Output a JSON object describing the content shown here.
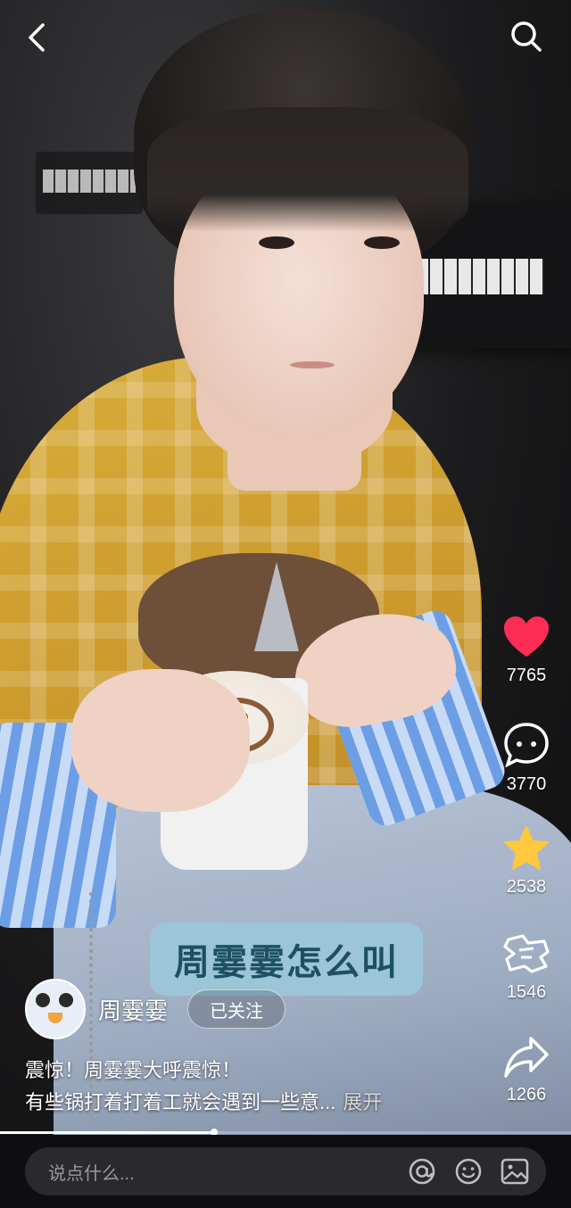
{
  "topbar": {
    "back_icon": "chevron-left-icon",
    "search_icon": "search-icon"
  },
  "actions": [
    {
      "icon": "heart-icon",
      "label": "7765",
      "color": "#ff2d55"
    },
    {
      "icon": "comment-icon",
      "label": "3770",
      "color": "#ffffff"
    },
    {
      "icon": "star-icon",
      "label": "2538",
      "color": "#ffc83d"
    },
    {
      "icon": "share-hand-icon",
      "label": "1546",
      "color": "#ffffff"
    },
    {
      "icon": "forward-icon",
      "label": "1266",
      "color": "#ffffff"
    }
  ],
  "caption_badge": "周霎霎怎么叫",
  "author": {
    "name": "周霎霎",
    "follow_label": "已关注"
  },
  "description": {
    "line1": "震惊！周霎霎大呼震惊！",
    "line2": "有些锅打着打着工就会遇到一些意...",
    "expand": "展开"
  },
  "progress": {
    "value_fraction": 0.375
  },
  "comment_bar": {
    "placeholder": "说点什么...",
    "icons": [
      "at-icon",
      "emoji-icon",
      "image-icon"
    ]
  }
}
